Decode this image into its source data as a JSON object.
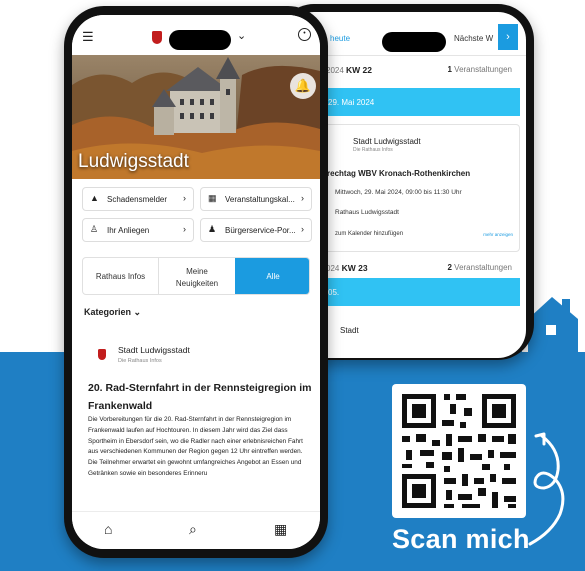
{
  "brand": {
    "primary": "#1b9be0",
    "band": "#1f7fc4",
    "date_bar": "#30c2f3"
  },
  "back_screen": {
    "tab_today": "heute",
    "tab_next": "Nächste W",
    "arrow_icon": "chevron-right-icon",
    "week1": {
      "prefix": "2024",
      "kw": "KW 22",
      "count": "1",
      "count_label": "Veranstaltungen"
    },
    "date1": "29. Mai 2024",
    "event": {
      "org": "Stadt Ludwigsstadt",
      "org_sub": "Die Rathaus Infos",
      "title": "rechtag WBV Kronach-Rothenkirchen",
      "time": "Mittwoch, 29. Mai 2024, 09:00 bis 11:30 Uhr",
      "location": "Rathaus Ludwigsstadt",
      "calendar": "zum Kalender hinzufügen",
      "more": "mehr anzeigen"
    },
    "week2": {
      "prefix": "024",
      "kw": "KW 23",
      "count": "2",
      "count_label": "Veranstaltungen"
    },
    "date2": "05.",
    "org2": "Stadt"
  },
  "front_screen": {
    "icons": {
      "menu": "hamburger-menu-icon",
      "crest": "coat-of-arms-icon",
      "dropdown": "chevron-down-icon",
      "user": "user-circle-icon",
      "bell": "bell-icon"
    },
    "city_name": "Ludwigsstadt",
    "quick_buttons": [
      {
        "label": "Schadensmelder",
        "icon": "warning-icon"
      },
      {
        "label": "Veranstaltungskal...",
        "icon": "calendar-icon"
      },
      {
        "label": "Ihr Anliegen",
        "icon": "person-edit-icon"
      },
      {
        "label": "Bürgerservice-Por...",
        "icon": "people-icon"
      }
    ],
    "tabs": [
      {
        "label": "Rathaus Infos"
      },
      {
        "label": "Meine Neuigkeiten"
      },
      {
        "label": "Alle",
        "active": true
      }
    ],
    "categories_label": "Kategorien",
    "news": {
      "org": "Stadt Ludwigsstadt",
      "org_sub": "Die Rathaus Infos",
      "title": "20. Rad-Sternfahrt in der Rennsteigregion im Frankenwald",
      "body": "Die Vorbereitungen für die 20. Rad-Sternfahrt in der Rennsteigregion im Frankenwald laufen auf Hochtouren. In diesem Jahr wird das Ziel dass Sportheim in Ebersdorf sein, wo die Radler nach einer erlebnisreichen Fahrt aus verschiedenen Kommunen der Region gegen 12 Uhr eintreffen werden. Die Teilnehmer erwartet ein gewohnt umfangreiches Angebot an Essen und Getränken sowie ein besonderes Erinneru"
    },
    "nav": [
      {
        "icon": "home-icon"
      },
      {
        "icon": "search-icon"
      },
      {
        "icon": "calendar-icon"
      }
    ]
  },
  "promo": {
    "cta": "Scan mich",
    "qr_icon": "qr-code-icon"
  }
}
